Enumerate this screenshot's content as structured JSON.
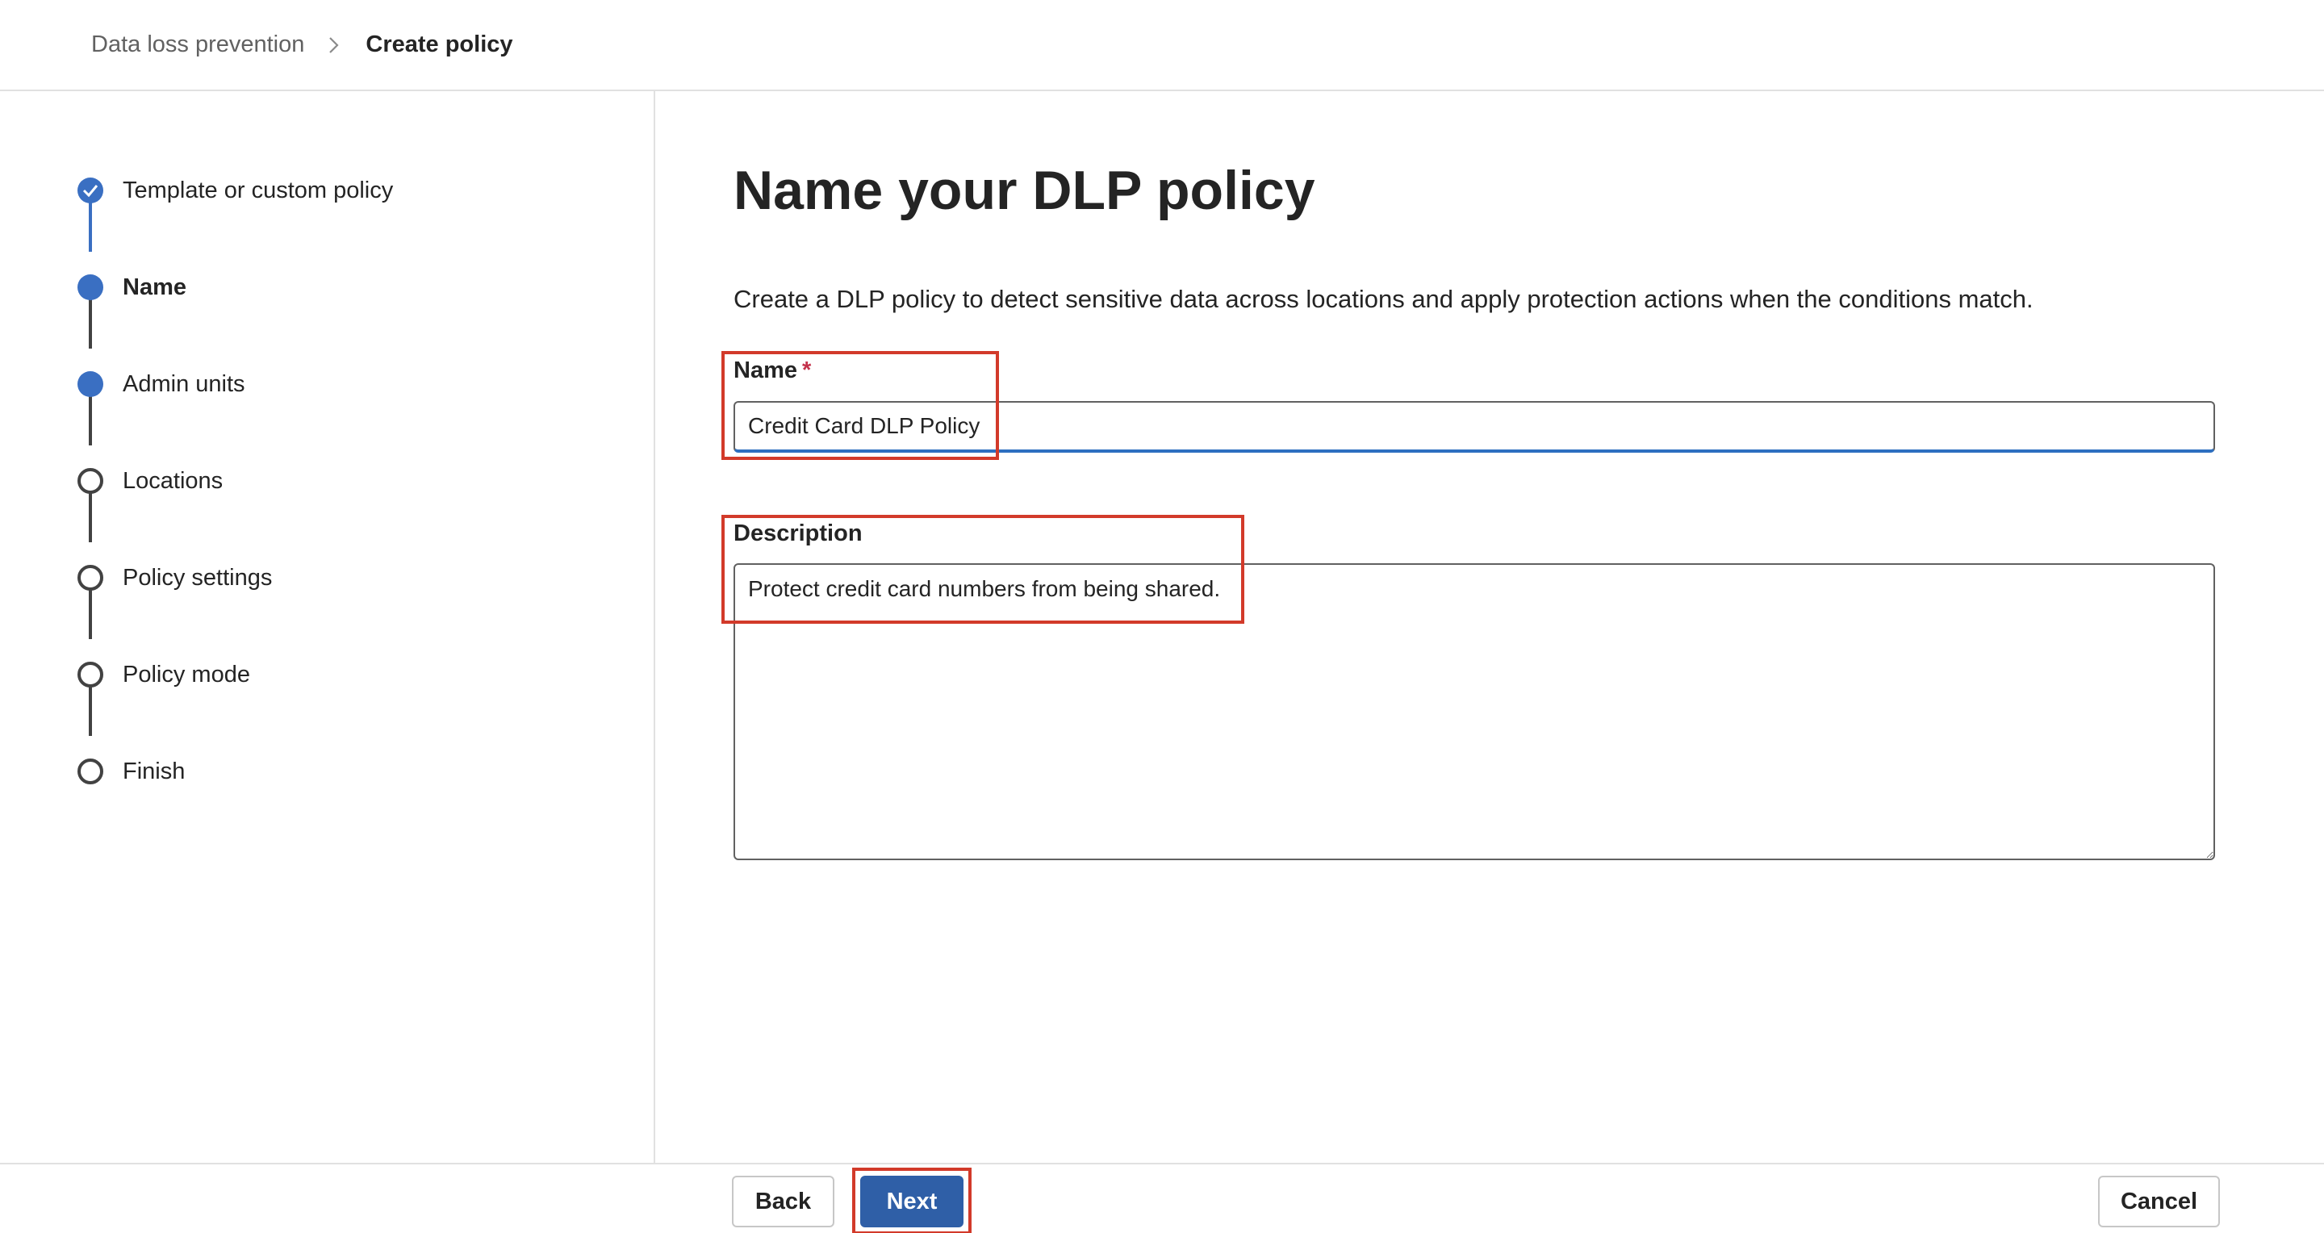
{
  "breadcrumb": {
    "parent": "Data loss prevention",
    "separator_icon": "chevron-right-icon",
    "current": "Create policy"
  },
  "stepper": {
    "steps": [
      {
        "label": "Template or custom policy",
        "state": "completed"
      },
      {
        "label": "Name",
        "state": "current"
      },
      {
        "label": "Admin units",
        "state": "reached"
      },
      {
        "label": "Locations",
        "state": "not-started"
      },
      {
        "label": "Policy settings",
        "state": "not-started"
      },
      {
        "label": "Policy mode",
        "state": "not-started"
      },
      {
        "label": "Finish",
        "state": "not-started"
      }
    ]
  },
  "main": {
    "title": "Name your DLP policy",
    "intro": "Create a DLP policy to detect sensitive data across locations and apply protection actions when the conditions match.",
    "name_field": {
      "label": "Name",
      "required_mark": "*",
      "value": "Credit Card DLP Policy"
    },
    "description_field": {
      "label": "Description",
      "value": "Protect credit card numbers from being shared."
    }
  },
  "footer": {
    "back_label": "Back",
    "next_label": "Next",
    "cancel_label": "Cancel"
  },
  "colors": {
    "accent": "#3a6fc2",
    "primary_button": "#2f5fa7",
    "highlight_box": "#d23a2a",
    "required": "#c4314b"
  }
}
